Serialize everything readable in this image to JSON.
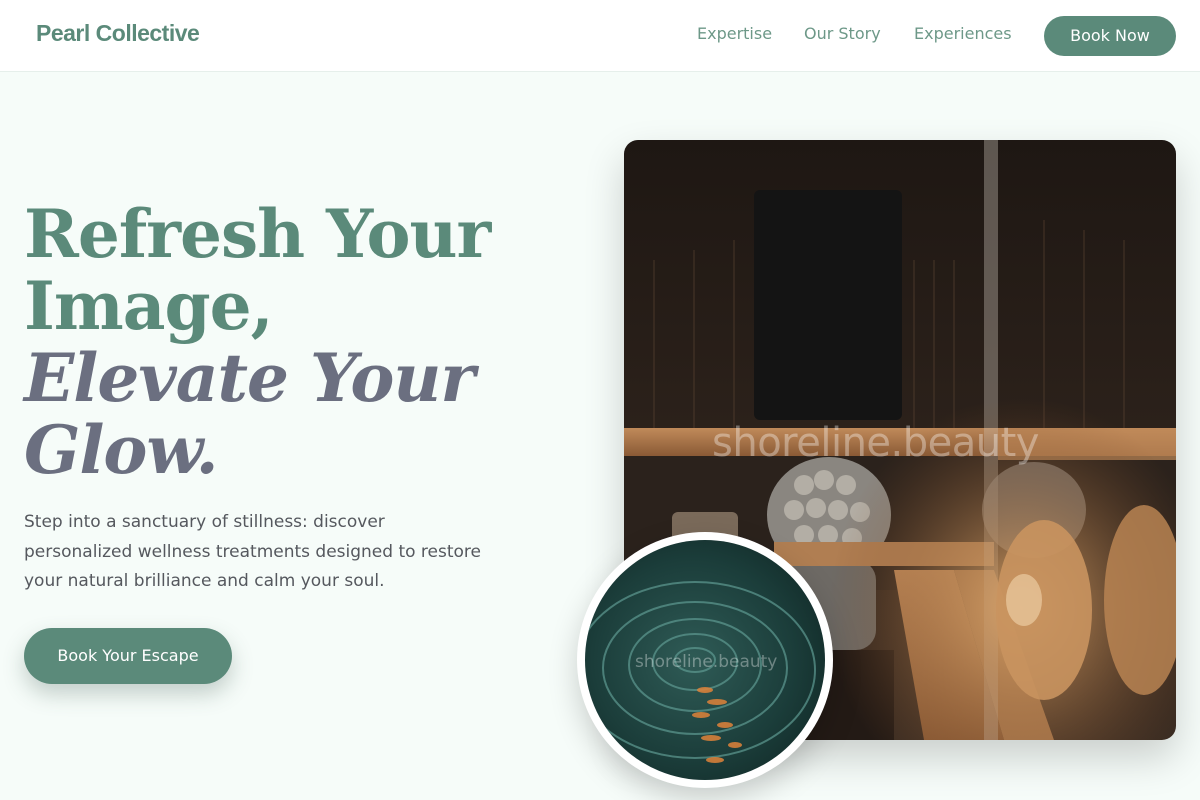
{
  "header": {
    "logo": "Pearl Collective",
    "nav": [
      "Expertise",
      "Our Story",
      "Experiences"
    ],
    "book_label": "Book Now"
  },
  "hero": {
    "title_line1": "Refresh Your",
    "title_line2": "Image,",
    "title_line3": "Elevate Your",
    "title_line4": "Glow.",
    "description": "Step into a sanctuary of stillness: discover personalized wellness treatments designed to restore your natural brilliance and calm your soul.",
    "cta_label": "Book Your Escape"
  },
  "images": {
    "main_watermark": "shoreline.beauty",
    "circle_watermark": "shoreline.beauty"
  },
  "colors": {
    "accent": "#5b8a7a",
    "italic_title": "#6b6f80",
    "background": "#f6fcf9"
  }
}
